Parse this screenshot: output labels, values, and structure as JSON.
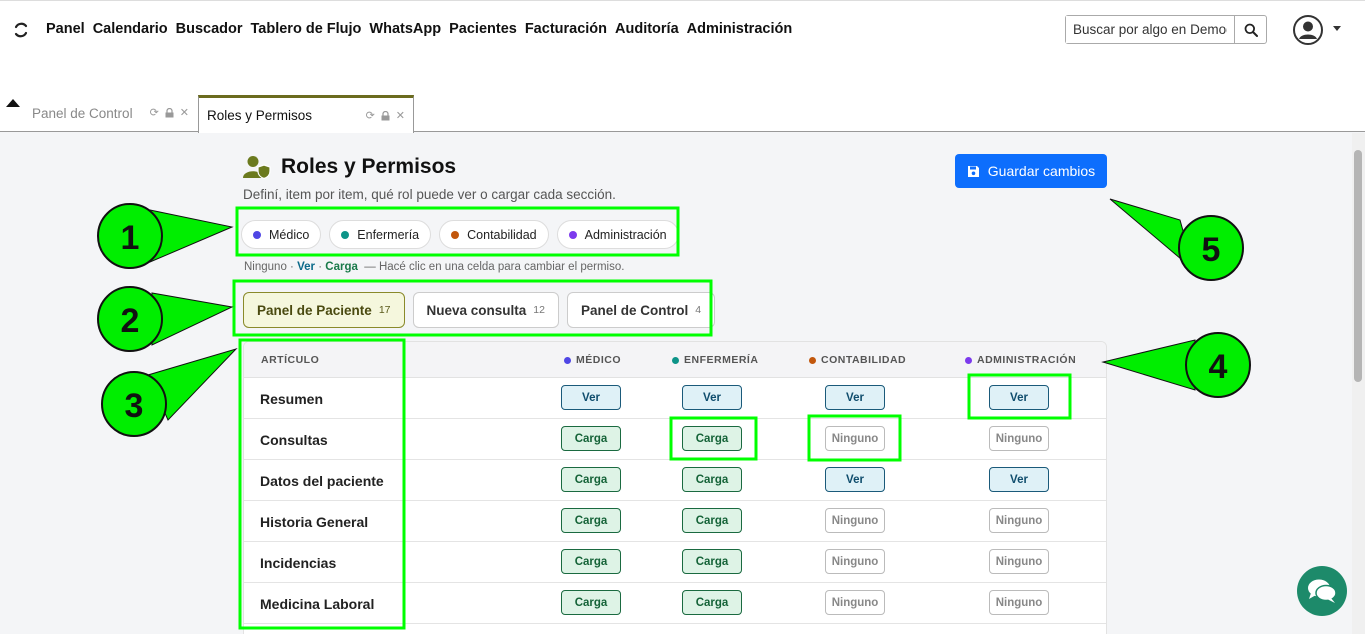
{
  "nav": {
    "links": [
      "Panel",
      "Calendario",
      "Buscador",
      "Tablero de Flujo",
      "WhatsApp",
      "Pacientes",
      "Facturación",
      "Auditoría",
      "Administración"
    ],
    "search_placeholder": "Buscar por algo en Demografía"
  },
  "tabs": [
    {
      "label": "Panel de Control"
    },
    {
      "label": "Roles y Permisos"
    }
  ],
  "header": {
    "title": "Roles y Permisos",
    "subtitle": "Definí, item por item, qué rol puede ver o cargar cada sección.",
    "save_label": "Guardar cambios"
  },
  "roles": [
    {
      "label": "Médico",
      "color": "#4f46e5"
    },
    {
      "label": "Enfermería",
      "color": "#0d9488"
    },
    {
      "label": "Contabilidad",
      "color": "#c2570c"
    },
    {
      "label": "Administración",
      "color": "#7c3aed"
    }
  ],
  "legend": {
    "ninguno": "Ninguno",
    "sep": "·",
    "ver": "Ver",
    "carga": "Carga",
    "hint": "— Hacé clic en una celda para cambiar el permiso."
  },
  "sections": [
    {
      "label": "Panel de Paciente",
      "count": "17"
    },
    {
      "label": "Nueva consulta",
      "count": "12"
    },
    {
      "label": "Panel de Control",
      "count": "4"
    }
  ],
  "table": {
    "headers": [
      "ARTÍCULO",
      "MÉDICO",
      "ENFERMERÍA",
      "CONTABILIDAD",
      "ADMINISTRACIÓN"
    ],
    "rows": [
      {
        "label": "Resumen",
        "perms": [
          "Ver",
          "Ver",
          "Ver",
          "Ver"
        ]
      },
      {
        "label": "Consultas",
        "perms": [
          "Carga",
          "Carga",
          "Ninguno",
          "Ninguno"
        ]
      },
      {
        "label": "Datos del paciente",
        "perms": [
          "Carga",
          "Carga",
          "Ver",
          "Ver"
        ]
      },
      {
        "label": "Historia General",
        "perms": [
          "Carga",
          "Carga",
          "Ninguno",
          "Ninguno"
        ]
      },
      {
        "label": "Incidencias",
        "perms": [
          "Carga",
          "Carga",
          "Ninguno",
          "Ninguno"
        ]
      },
      {
        "label": "Medicina Laboral",
        "perms": [
          "Carga",
          "Carga",
          "Ninguno",
          "Ninguno"
        ]
      }
    ]
  },
  "annotations": [
    "1",
    "2",
    "3",
    "4",
    "5"
  ],
  "colors": {
    "highlight": "#00ff00",
    "marker": "#00ee00",
    "primary": "#0d6efd",
    "accent": "#6b6b1e"
  }
}
